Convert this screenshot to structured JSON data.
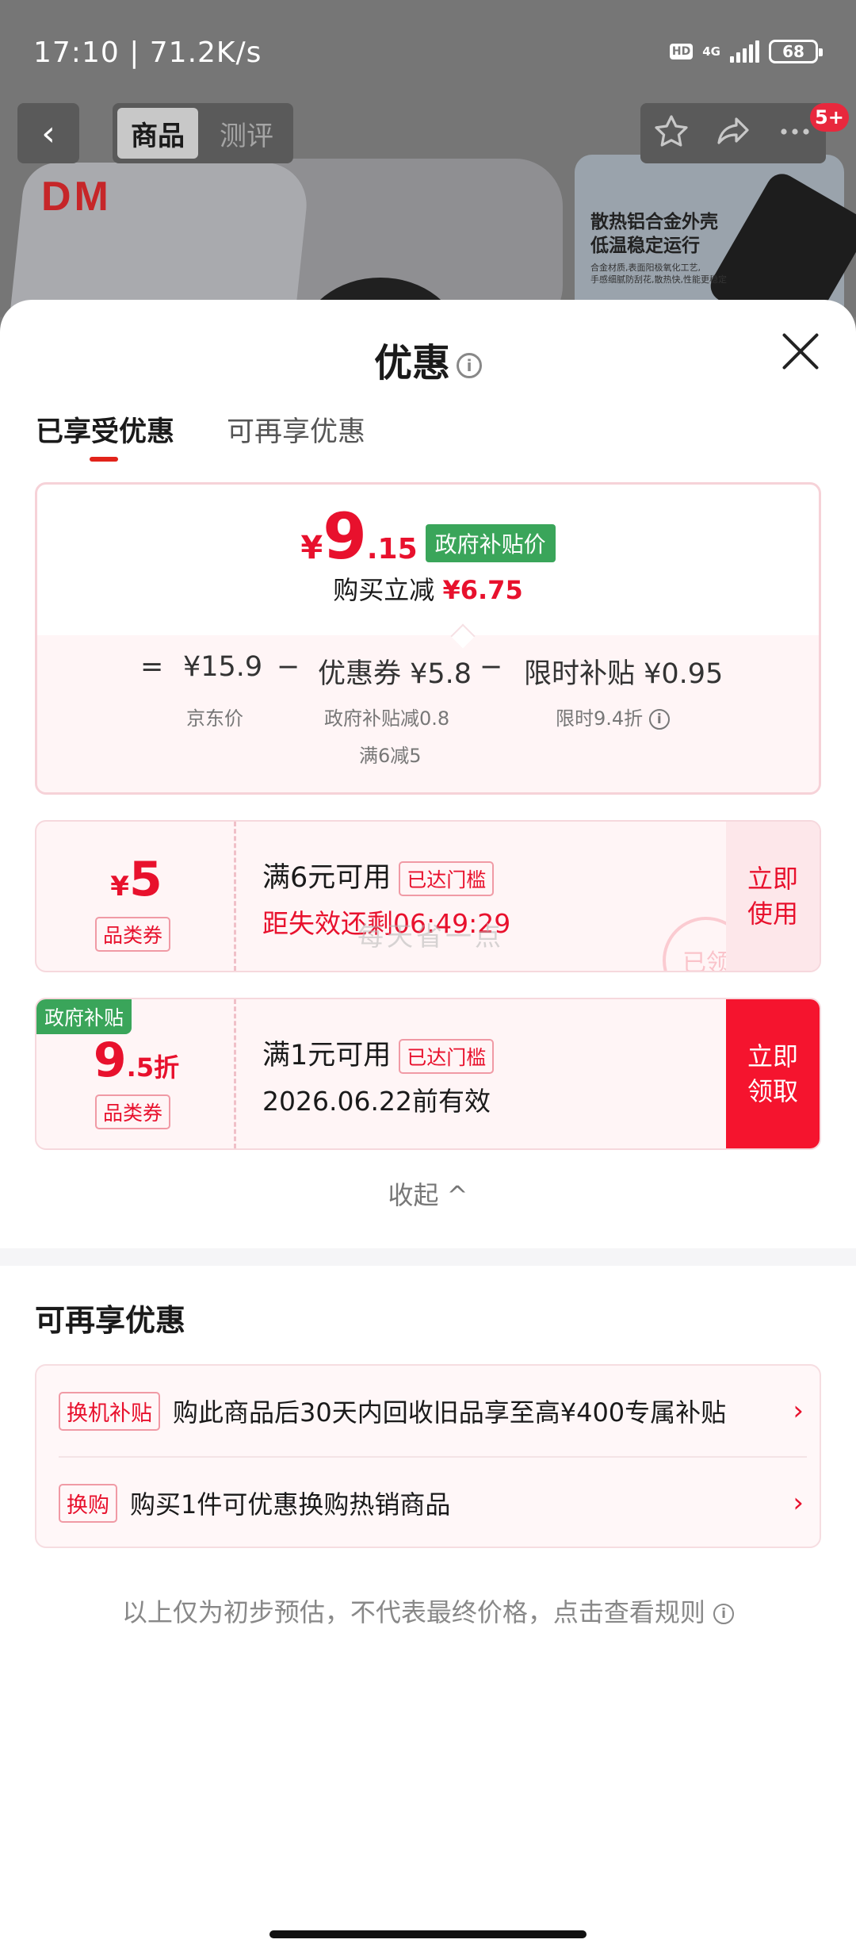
{
  "status_bar": {
    "time": "17:10 | 71.2K/s",
    "hd": "HD",
    "network": "4G",
    "battery": "68"
  },
  "top_nav": {
    "tab_product": "商品",
    "tab_review": "测评",
    "badge": "5+"
  },
  "background": {
    "brand_logo": "DM",
    "promo_title_1": "散热铝合金外壳",
    "promo_title_2": "低温稳定运行",
    "promo_small_1": "合金材质,表面阳极氧化工艺,",
    "promo_small_2": "手感细腻防刮花,散热快,性能更稳定"
  },
  "sheet": {
    "title": "优惠",
    "info_icon": "i",
    "tabs": [
      {
        "label": "已享受优惠"
      },
      {
        "label": "可再享优惠"
      }
    ],
    "price": {
      "currency": "¥",
      "final_int": "9",
      "final_dec": ".15",
      "gov_tag": "政府补贴价",
      "reduce_label": "购买立减",
      "reduce_value": "¥6.75",
      "eq": "=",
      "jd_price": "¥15.9",
      "minus": "−",
      "coupon_label": "优惠券 ¥5.8",
      "limited_label": "限时补贴 ¥0.95",
      "jd_sub": "京东价",
      "coupon_sub_1": "政府补贴减0.8",
      "coupon_sub_2": "满6减5",
      "limited_sub": "限时9.4折"
    },
    "coupons": [
      {
        "amount_sym": "¥",
        "amount": "5",
        "type": "品类券",
        "condition": "满6元可用",
        "reached": "已达门槛",
        "line2": "距失效还剩06:49:29",
        "button": "立即\n使用",
        "stamp": "已领"
      },
      {
        "gov_label": "政府补贴",
        "amount": "9",
        "amount_suffix": ".5折",
        "type": "品类券",
        "condition": "满1元可用",
        "reached": "已达门槛",
        "line2": "2026.06.22前有效",
        "button": "立即\n领取"
      }
    ],
    "watermark": "每天省一点",
    "collapse": "收起 ^",
    "more_title": "可再享优惠",
    "more_items": [
      {
        "tag": "换机补贴",
        "text": "购此商品后30天内回收旧品享至高¥400专属补贴",
        "arrow": "›"
      },
      {
        "tag": "换购",
        "text": "购买1件可优惠换购热销商品",
        "arrow": "›"
      }
    ],
    "disclaimer": "以上仅为初步预估，不代表最终价格，点击查看规则"
  },
  "colors": {
    "accent_red": "#e8112d",
    "gov_green": "#3aa55a",
    "card_pink": "#fff5f6"
  }
}
